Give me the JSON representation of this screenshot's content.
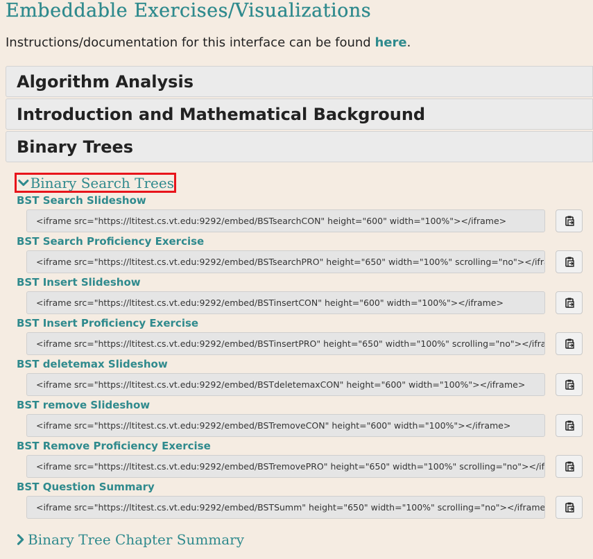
{
  "page": {
    "title": "Embeddable Exercises/Visualizations",
    "intro_text": "Instructions/documentation for this interface can be found ",
    "intro_link": "here",
    "intro_end": "."
  },
  "sections": [
    {
      "label": "Algorithm Analysis"
    },
    {
      "label": "Introduction and Mathematical Background"
    },
    {
      "label": "Binary Trees"
    }
  ],
  "subsection": {
    "label": "Binary Search Trees",
    "highlight_color": "#e8141b"
  },
  "items": [
    {
      "label": "BST Search Slideshow",
      "code": "<iframe src=\"https://ltitest.cs.vt.edu:9292/embed/BSTsearchCON\" height=\"600\" width=\"100%\"></iframe>"
    },
    {
      "label": "BST Search Proficiency Exercise",
      "code": "<iframe src=\"https://ltitest.cs.vt.edu:9292/embed/BSTsearchPRO\" height=\"650\" width=\"100%\" scrolling=\"no\"></iframe>"
    },
    {
      "label": "BST Insert Slideshow",
      "code": "<iframe src=\"https://ltitest.cs.vt.edu:9292/embed/BSTinsertCON\" height=\"600\" width=\"100%\"></iframe>"
    },
    {
      "label": "BST Insert Proficiency Exercise",
      "code": "<iframe src=\"https://ltitest.cs.vt.edu:9292/embed/BSTinsertPRO\" height=\"650\" width=\"100%\" scrolling=\"no\"></iframe>"
    },
    {
      "label": "BST deletemax Slideshow",
      "code": "<iframe src=\"https://ltitest.cs.vt.edu:9292/embed/BSTdeletemaxCON\" height=\"600\" width=\"100%\"></iframe>"
    },
    {
      "label": "BST remove Slideshow",
      "code": "<iframe src=\"https://ltitest.cs.vt.edu:9292/embed/BSTremoveCON\" height=\"600\" width=\"100%\"></iframe>"
    },
    {
      "label": "BST Remove Proficiency Exercise",
      "code": "<iframe src=\"https://ltitest.cs.vt.edu:9292/embed/BSTremovePRO\" height=\"650\" width=\"100%\" scrolling=\"no\"></iframe>"
    },
    {
      "label": "BST Question Summary",
      "code": "<iframe src=\"https://ltitest.cs.vt.edu:9292/embed/BSTSumm\" height=\"650\" width=\"100%\" scrolling=\"no\"></iframe>"
    }
  ],
  "bottom_link": {
    "label": "Binary Tree Chapter Summary"
  },
  "colors": {
    "accent": "#2f8a8d",
    "background": "#f5ece2"
  },
  "icons": {
    "copy": "clipboard-icon",
    "expanded": "chevron-down-icon",
    "collapsed": "chevron-right-icon"
  }
}
